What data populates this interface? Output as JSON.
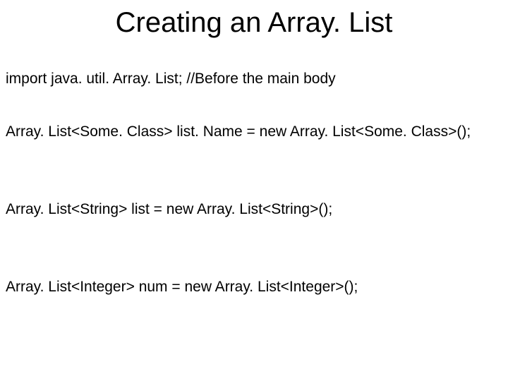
{
  "title": "Creating an Array. List",
  "lines": {
    "l1": "import java. util. Array. List; //Before the main body",
    "l2": "Array. List<Some. Class> list. Name = new Array. List<Some. Class>();",
    "l3": "Array. List<String> list = new Array. List<String>();",
    "l4": "Array. List<Integer> num = new Array. List<Integer>();"
  }
}
